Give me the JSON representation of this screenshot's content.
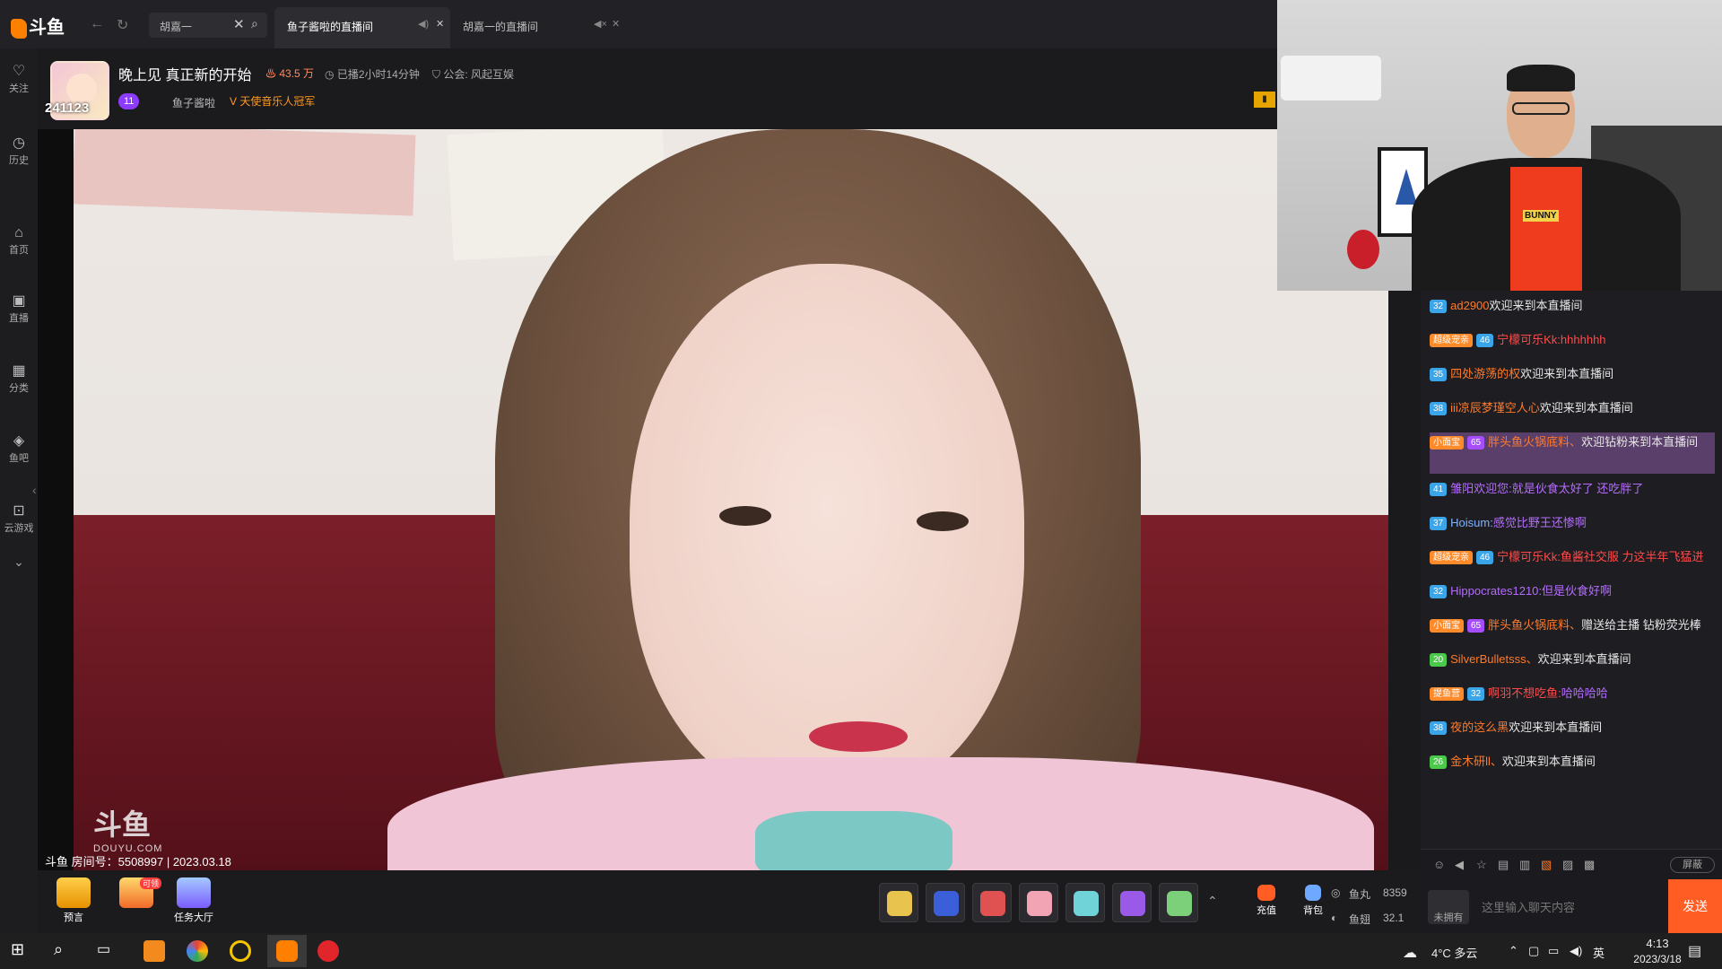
{
  "app": {
    "logo_text": "斗鱼"
  },
  "topbar": {
    "search_value": "胡嘉一",
    "tabs": [
      {
        "label": "鱼子酱啦的直播间",
        "active": true
      },
      {
        "label": "胡嘉一的直播间",
        "active": false
      }
    ]
  },
  "left_rail": [
    {
      "icon": "heart-icon",
      "label": "关注"
    },
    {
      "icon": "clock-icon",
      "label": "历史"
    },
    {
      "icon": "home-icon",
      "label": "首页"
    },
    {
      "icon": "tv-icon",
      "label": "直播"
    },
    {
      "icon": "grid-icon",
      "label": "分类"
    },
    {
      "icon": "fish-icon",
      "label": "鱼吧"
    },
    {
      "icon": "gamepad-icon",
      "label": "云游戏"
    }
  ],
  "header": {
    "avatar_number": "241123",
    "title": "晚上见  真正新的开始",
    "hot": "43.5 万",
    "live_duration": "已播2小时14分钟",
    "guild": "公会: 风起互娱",
    "level_badge": "11",
    "host_name": "鱼子酱啦",
    "champion": "天使音乐人冠军"
  },
  "video": {
    "watermark_main": "斗鱼",
    "watermark_sub": "DOUYU.COM",
    "room_info": "斗鱼 房间号：5508997 | 2023.03.18"
  },
  "inset": {
    "shirt_text": "BUNNY"
  },
  "chat": [
    {
      "lv": "32",
      "lvc": "b",
      "name": "ad2900",
      "nc": "name-o",
      "msg": "欢迎来到本直播间"
    },
    {
      "lv": "46",
      "lvc": "b",
      "badge": "超级宠亲",
      "name": "宁檬可乐Kk:",
      "nc": "name-r",
      "msg": "hhhhhhh",
      "mc": "name-r"
    },
    {
      "lv": "35",
      "lvc": "b",
      "name": "四处游荡的权",
      "nc": "name-o",
      "msg": "欢迎来到本直播间"
    },
    {
      "lv": "38",
      "lvc": "b",
      "name": "iii凉辰梦瑾空人心",
      "nc": "name-o",
      "msg": "欢迎来到本直播间"
    },
    {
      "lv": "65",
      "lvc": "p",
      "badge": "小面宝",
      "name": "胖头鱼火锅底料、",
      "nc": "name-o",
      "msg": "欢迎钻粉来到本直播间",
      "hl": true
    },
    {
      "lv": "41",
      "lvc": "b",
      "name": "雏阳欢迎您:",
      "nc": "name-p",
      "msg": "就是伙食太好了 还吃胖了",
      "mc": "name-p"
    },
    {
      "lv": "37",
      "lvc": "b",
      "name": "Hoisum:",
      "nc": "name-b",
      "msg": "感觉比野王还惨啊",
      "mc": "name-p"
    },
    {
      "lv": "46",
      "lvc": "b",
      "badge": "超级宠亲",
      "name": "宁檬可乐Kk:",
      "nc": "name-r",
      "msg": "鱼酱社交服 力这半年飞猛进",
      "mc": "name-r"
    },
    {
      "lv": "32",
      "lvc": "b",
      "name": "Hippocrates1210:",
      "nc": "name-p",
      "msg": "但是伙食好啊",
      "mc": "name-p"
    },
    {
      "lv": "65",
      "lvc": "p",
      "badge": "小面宝",
      "name": "胖头鱼火锅底料、",
      "nc": "name-o",
      "msg": "赠送给主播 钻粉荧光棒"
    },
    {
      "lv": "20",
      "lvc": "g",
      "name": "SilverBulletsss、",
      "nc": "name-o",
      "msg": "欢迎来到本直播间"
    },
    {
      "lv": "32",
      "lvc": "b",
      "badge": "提鱼营",
      "name": "啊羽不想吃鱼:",
      "nc": "name-r",
      "msg": "哈哈哈哈",
      "mc": "name-p"
    },
    {
      "lv": "38",
      "lvc": "b",
      "name": "夜的这么黑",
      "nc": "name-o",
      "msg": "欢迎来到本直播间"
    },
    {
      "lv": "26",
      "lvc": "g",
      "name": "金木研ll、",
      "nc": "name-o",
      "msg": "欢迎来到本直播间"
    }
  ],
  "chat_tools": {
    "shield_label": "屏蔽"
  },
  "input": {
    "owned_label": "未拥有",
    "placeholder": "这里输入聊天内容",
    "send_label": "发送"
  },
  "giftbar": {
    "forecast_label": "预言",
    "gift_badge": "可领",
    "task_label": "任务大厅",
    "recharge_label": "充值",
    "backpack_label": "背包",
    "fishball_label": "鱼丸",
    "fishball_value": "8359",
    "fishwing_label": "鱼翅",
    "fishwing_value": "32.1"
  },
  "taskbar": {
    "weather": "4°C  多云",
    "ime": "英",
    "time": "4:13",
    "date": "2023/3/18"
  }
}
